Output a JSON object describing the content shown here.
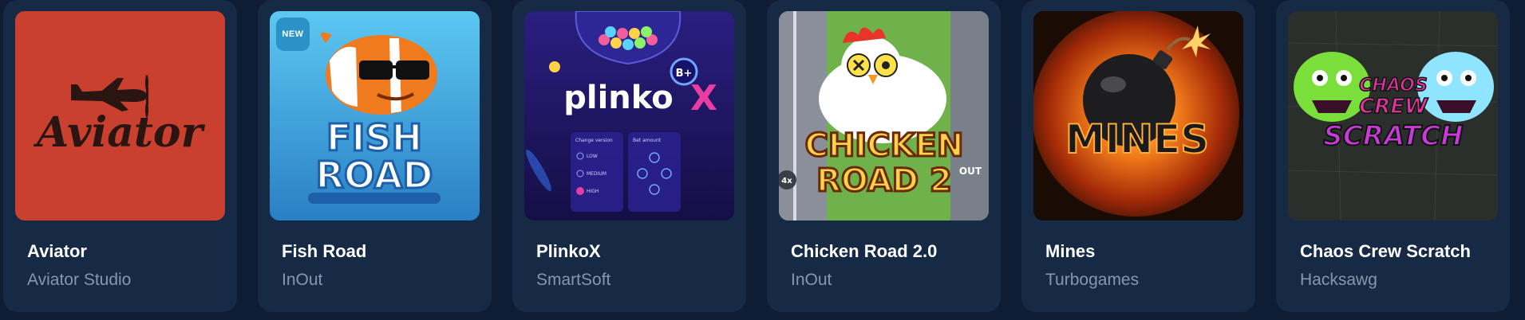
{
  "games": [
    {
      "title": "Aviator",
      "provider": "Aviator Studio",
      "logo_text": "Aviator",
      "thumb_icon": "airplane-icon"
    },
    {
      "title": "Fish Road",
      "provider": "InOut",
      "badge": "NEW",
      "logo_line1": "FISH",
      "logo_line2": "ROAD",
      "thumb_icon": "clownfish-icon"
    },
    {
      "title": "PlinkoX",
      "provider": "SmartSoft",
      "logo_text": "plinko",
      "logo_accent": "X",
      "multiplier_badge": "B+",
      "panel_left_heading": "Change version",
      "panel_right_heading": "Bet amount",
      "panel_options": [
        "LOW",
        "MEDIUM",
        "HIGH"
      ],
      "thumb_icon": "plinko-board-icon"
    },
    {
      "title": "Chicken Road 2.0",
      "provider": "InOut",
      "logo_line1": "CHICKEN",
      "logo_line2": "ROAD 2",
      "side_label": "OUT",
      "multiplier": "4x",
      "thumb_icon": "chicken-icon"
    },
    {
      "title": "Mines",
      "provider": "Turbogames",
      "logo_text": "MINES",
      "thumb_icon": "bomb-icon"
    },
    {
      "title": "Chaos Crew Scratch",
      "provider": "Hacksawg",
      "logo_line1": "CHAOS",
      "logo_line2": "CREW",
      "logo_line3": "SCRATCH",
      "thumb_icon": "monster-icon"
    }
  ],
  "colors": {
    "page_bg": "#0f1d33",
    "card_bg": "#162a45",
    "title": "#ffffff",
    "provider": "#8797ad",
    "aviator_bg": "#c9402f",
    "fishroad_bg": "#4ab8e8",
    "plinko_bg": "#1c1560",
    "chicken_bg": "#6fb24a",
    "mines_bg": "#1a0b05",
    "chaos_bg": "#2b2f2c"
  }
}
